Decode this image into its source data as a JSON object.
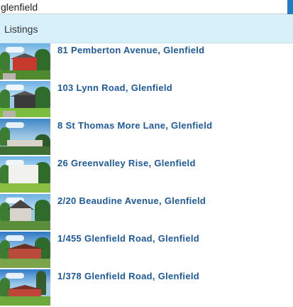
{
  "search": {
    "value": "glenfield",
    "placeholder": ""
  },
  "section": {
    "title": "Listings"
  },
  "listings": [
    {
      "address": "81 Pemberton Avenue, Glenfield"
    },
    {
      "address": "103 Lynn Road, Glenfield"
    },
    {
      "address": "8 St Thomas More Lane, Glenfield"
    },
    {
      "address": "26 Greenvalley Rise, Glenfield"
    },
    {
      "address": "2/20 Beaudine Avenue, Glenfield"
    },
    {
      "address": "1/455 Glenfield Road, Glenfield"
    },
    {
      "address": "1/378 Glenfield Road, Glenfield"
    }
  ],
  "colors": {
    "accent": "#1e7fc6",
    "header_background": "#d8f0fa",
    "link": "#1d5a9c"
  }
}
